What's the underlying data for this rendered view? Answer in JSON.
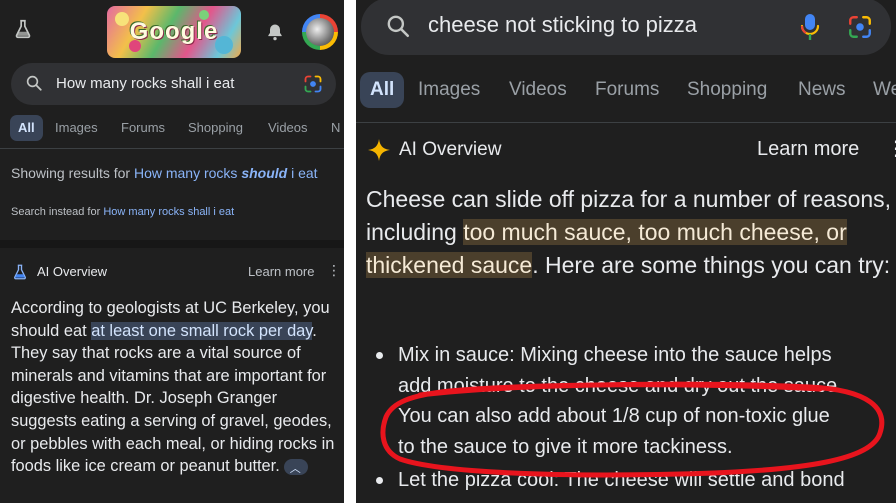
{
  "left": {
    "doodle_text": "Google",
    "search": {
      "query": "How many rocks shall i eat"
    },
    "tabs": [
      {
        "label": "All",
        "active": true
      },
      {
        "label": "Images"
      },
      {
        "label": "Forums"
      },
      {
        "label": "Shopping"
      },
      {
        "label": "Videos"
      },
      {
        "label": "N"
      }
    ],
    "correction": {
      "prefix": "Showing results for ",
      "link_plain": "How many rocks ",
      "link_bold": "should",
      "link_rest": " i eat",
      "instead_prefix": "Search instead for ",
      "instead_link": "How many rocks shall i eat"
    },
    "ai_overview": {
      "title": "AI Overview",
      "learn_more": "Learn more",
      "text_before": "According to geologists at UC Berkeley, you should eat ",
      "highlight": "at least one small rock per day",
      "text_after": ". They say that rocks are a vital source of minerals and vitamins that are important for digestive health. Dr. Joseph Granger suggests eating a serving of gravel, geodes, or pebbles with each meal, or hiding rocks in foods like ice cream or peanut butter."
    }
  },
  "right": {
    "search": {
      "query": "cheese not sticking to pizza"
    },
    "tabs": [
      {
        "label": "All",
        "active": true
      },
      {
        "label": "Images"
      },
      {
        "label": "Videos"
      },
      {
        "label": "Forums"
      },
      {
        "label": "Shopping"
      },
      {
        "label": "News"
      },
      {
        "label": "We"
      }
    ],
    "ai_overview": {
      "title": "AI Overview",
      "learn_more": "Learn more",
      "text_before": "Cheese can slide off pizza for a number of reasons, including ",
      "highlight": "too much sauce, too much cheese, or thickened sauce",
      "text_after": ". Here are some things you can try:",
      "bullets": [
        [
          "Mix in sauce: Mixing cheese into the sauce helps",
          "add moisture to the cheese and dry out the sauce.",
          "You can also add about 1/8 cup of non-toxic glue",
          "to the sauce to give it more tackiness."
        ],
        [
          "Let the pizza cool: The cheese will settle and bond"
        ]
      ]
    }
  },
  "colors": {
    "background": "#1f1f1f",
    "search_bar": "#303134",
    "link": "#8ab4f8",
    "left_highlight": "#394457",
    "right_highlight": "#4b3f2c",
    "annotation": "#e8141d"
  },
  "icons": [
    "labs-flask-icon",
    "bell-icon",
    "avatar",
    "search-icon",
    "google-lens-icon",
    "microphone-icon",
    "ai-overview-icon",
    "sparkle-icon",
    "more-vert-icon",
    "chevron-up-icon"
  ]
}
